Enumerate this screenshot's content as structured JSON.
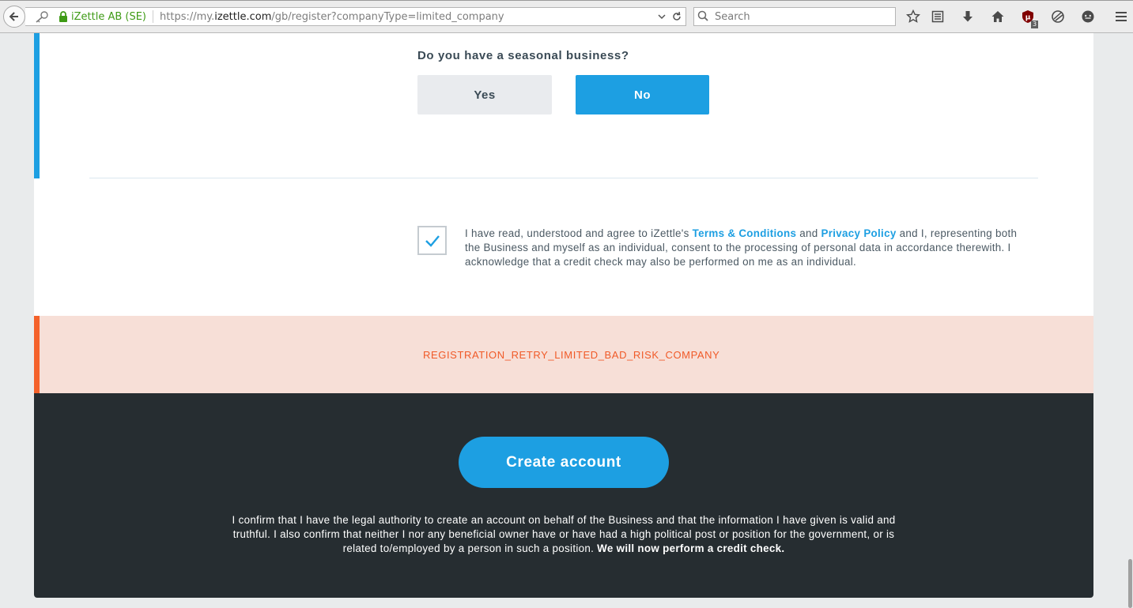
{
  "browser": {
    "site_identity": "iZettle AB (SE)",
    "url_prefix": "https://my.",
    "url_domain": "izettle.com",
    "url_path": "/gb/register?companyType=limited_company",
    "search_placeholder": "Search",
    "ublock_count": "3"
  },
  "form": {
    "seasonal_question": "Do you have a seasonal business?",
    "yes_label": "Yes",
    "no_label": "No",
    "selected": "No",
    "consent_checked": true,
    "consent_part1": "I have read, understood and agree to iZettle's ",
    "terms_link": "Terms & Conditions",
    "consent_and": " and ",
    "privacy_link": "Privacy Policy",
    "consent_part2": " and I, representing both the Business and myself as an individual, consent to the processing of personal data in accordance therewith. I acknowledge that a credit check may also be performed on me as an individual."
  },
  "error": {
    "message": "REGISTRATION_RETRY_LIMITED_BAD_RISK_COMPANY"
  },
  "footer": {
    "create_button": "Create account",
    "legal_text": "I confirm that I have the legal authority to create an account on behalf of the Business and that the information I have given is valid and truthful. I also confirm that neither I nor any beneficial owner have or have had a high political post or position for the government, or is related to/employed by a person in such a position. ",
    "legal_bold": "We will now perform a credit check."
  },
  "colors": {
    "accent_blue": "#1d9fe2",
    "error_orange": "#f4622b",
    "error_bg": "#f7dfd7",
    "footer_bg": "#262d31"
  }
}
